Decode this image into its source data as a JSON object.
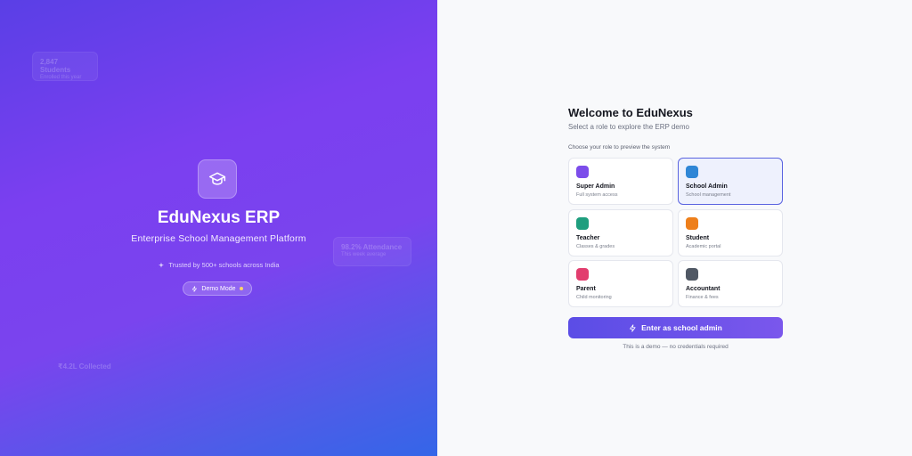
{
  "brand": {
    "title": "EduNexus ERP",
    "subtitle": "Enterprise School Management Platform",
    "trust_text": "Trusted by 500+ schools across India",
    "demo_pill": "Demo Mode",
    "logo_icon": "graduation-cap-icon"
  },
  "stats": [
    {
      "value": "2,847 Students",
      "label": "Enrolled this year"
    },
    {
      "value": "98.2% Attendance",
      "label": "This week average"
    },
    {
      "value": "₹4.2L Collected",
      "label": ""
    }
  ],
  "panel": {
    "heading": "Welcome to EduNexus",
    "subheading": "Select a role to explore the ERP demo",
    "choose_label": "Choose your role to preview the system",
    "roles": [
      {
        "name": "Super Admin",
        "desc": "Full system access",
        "color": "#7c4dea"
      },
      {
        "name": "School Admin",
        "desc": "School management",
        "color": "#2f86d6"
      },
      {
        "name": "Teacher",
        "desc": "Classes & grades",
        "color": "#1f9e7e"
      },
      {
        "name": "Student",
        "desc": "Academic portal",
        "color": "#ee7f1b"
      },
      {
        "name": "Parent",
        "desc": "Child monitoring",
        "color": "#e23d6e"
      },
      {
        "name": "Accountant",
        "desc": "Finance & fees",
        "color": "#505864"
      }
    ],
    "selected_role": "School Admin",
    "enter_button": "Enter as school admin",
    "demo_note": "This is a demo — no credentials required"
  },
  "colors": {
    "accent": "#5b4de6",
    "selected_border": "#5a63e0",
    "selected_bg": "#eef1fd"
  }
}
